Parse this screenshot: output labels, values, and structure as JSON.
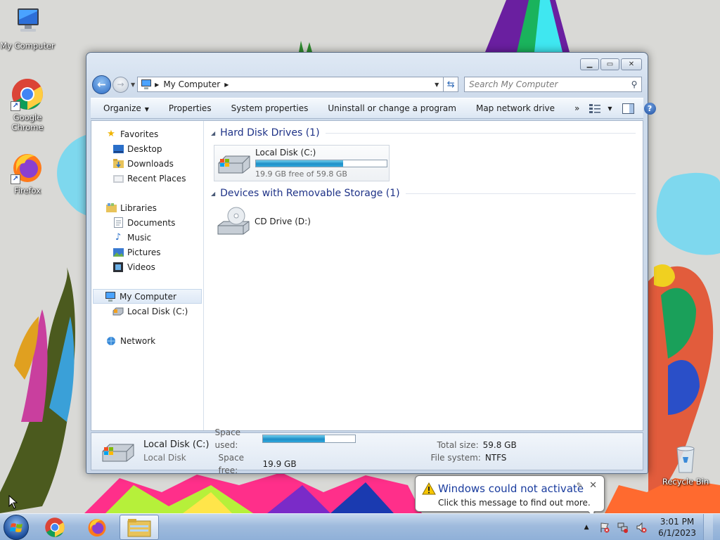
{
  "desktop": {
    "icons": [
      {
        "label": "My Computer",
        "icon": "computer-icon"
      },
      {
        "label": "Google Chrome",
        "icon": "chrome-icon",
        "shortcut": true
      },
      {
        "label": "Firefox",
        "icon": "firefox-icon",
        "shortcut": true
      },
      {
        "label": "Recycle Bin",
        "icon": "recycle-bin-icon"
      }
    ]
  },
  "window": {
    "address": {
      "segment": "My Computer"
    },
    "search": {
      "placeholder": "Search My Computer"
    },
    "commandbar": {
      "organize": "Organize",
      "properties": "Properties",
      "system_properties": "System properties",
      "uninstall": "Uninstall or change a program",
      "map_drive": "Map network drive",
      "more": "»"
    },
    "navpane": {
      "favorites": "Favorites",
      "desktop": "Desktop",
      "downloads": "Downloads",
      "recent_places": "Recent Places",
      "libraries": "Libraries",
      "documents": "Documents",
      "music": "Music",
      "pictures": "Pictures",
      "videos": "Videos",
      "my_computer": "My Computer",
      "local_disk": "Local Disk (C:)",
      "network": "Network"
    },
    "content": {
      "hdd_group": "Hard Disk Drives (1)",
      "removable_group": "Devices with Removable Storage (1)",
      "local_disk": {
        "name": "Local Disk (C:)",
        "free_text": "19.9 GB free of 59.8 GB",
        "used_fraction": 0.667
      },
      "cd_drive": {
        "name": "CD Drive (D:)"
      }
    },
    "details": {
      "name": "Local Disk (C:)",
      "type": "Local Disk",
      "space_used_label": "Space used:",
      "space_free_label": "Space free:",
      "space_free_value": "19.9 GB",
      "total_size_label": "Total size:",
      "total_size_value": "59.8 GB",
      "file_system_label": "File system:",
      "file_system_value": "NTFS",
      "used_fraction": 0.667
    }
  },
  "balloon": {
    "title": "Windows could not activate",
    "message": "Click this message to find out more."
  },
  "taskbar": {
    "pinned": [
      "chrome-icon",
      "firefox-icon",
      "explorer-icon"
    ],
    "clock": {
      "time": "3:01 PM",
      "date": "6/1/2023"
    }
  },
  "colors": {
    "group_header": "#1e3287",
    "bar_fill": "#1f8ec7",
    "balloon_title": "#1a3c9e"
  }
}
